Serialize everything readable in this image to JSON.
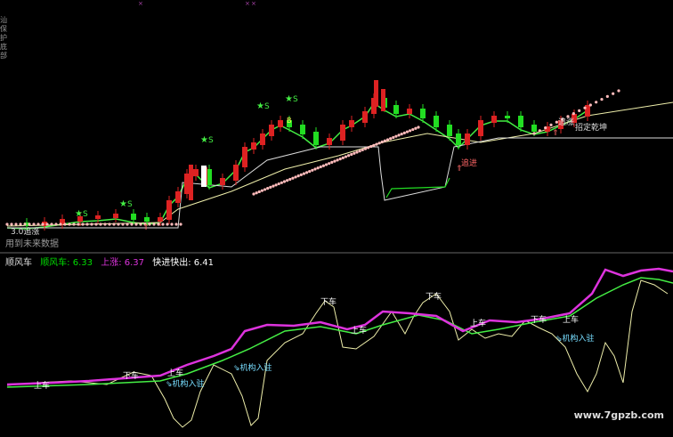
{
  "panels": {
    "main": {
      "signal_labels": {
        "s_marker": "S",
        "hold_marker": "B",
        "zhuizhang": "3.0追涨",
        "zhuijin": "追进",
        "zhuidie": "追涨",
        "zhaoding": "招定乾坤"
      },
      "future_note": "用到未来数据"
    },
    "indicator": {
      "name": "顺风车",
      "legend": [
        {
          "label": "顺风车: 6.33",
          "color": "#00dd00"
        },
        {
          "label": "上涨: 6.37",
          "color": "#dd33dd"
        },
        {
          "label": "快进快出: 6.41",
          "color": "#ffffff"
        }
      ],
      "annotations": {
        "shangche": "上车",
        "xiache": "下车",
        "jigou": "机构入驻"
      }
    }
  },
  "left_axis_glyphs": [
    "汕",
    "保",
    "护",
    "底",
    "部"
  ],
  "watermark": "www.7gpzb.com",
  "colors": {
    "up": "#dd2222",
    "down": "#22dd22",
    "pink_dots": "#ffbbbb",
    "magenta": "#dd33dd",
    "green_line": "#44ee44",
    "pale_line": "#eeeeaa",
    "white_line": "#dddddd"
  },
  "icons": [
    "star-icon",
    "arrow-up-icon",
    "arrow-down-icon"
  ]
}
